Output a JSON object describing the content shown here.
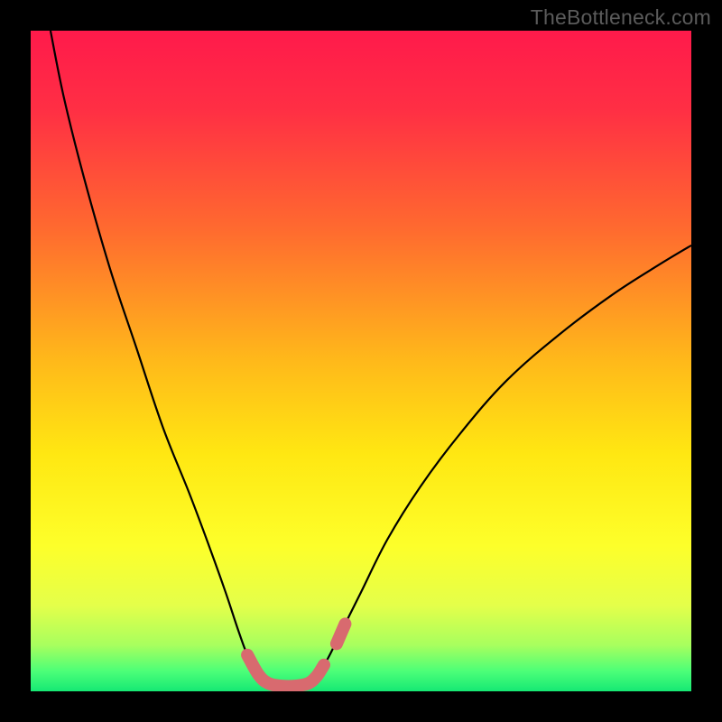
{
  "watermark": "TheBottleneck.com",
  "chart_data": {
    "type": "line",
    "title": "",
    "xlabel": "",
    "ylabel": "",
    "xlim": [
      0,
      100
    ],
    "ylim": [
      0,
      100
    ],
    "gradient_stops": [
      {
        "offset": 0.0,
        "color": "#ff1a4b"
      },
      {
        "offset": 0.12,
        "color": "#ff2f44"
      },
      {
        "offset": 0.3,
        "color": "#ff6a2f"
      },
      {
        "offset": 0.5,
        "color": "#ffb91a"
      },
      {
        "offset": 0.64,
        "color": "#ffe712"
      },
      {
        "offset": 0.78,
        "color": "#fdff2a"
      },
      {
        "offset": 0.87,
        "color": "#e4ff4a"
      },
      {
        "offset": 0.93,
        "color": "#a8ff5e"
      },
      {
        "offset": 0.97,
        "color": "#4bff78"
      },
      {
        "offset": 1.0,
        "color": "#16e874"
      }
    ],
    "series": [
      {
        "name": "curve",
        "stroke": "#000000",
        "width": 2.2,
        "points": [
          {
            "x": 3.0,
            "y": 100.0
          },
          {
            "x": 5.0,
            "y": 90.0
          },
          {
            "x": 8.0,
            "y": 78.0
          },
          {
            "x": 12.0,
            "y": 64.0
          },
          {
            "x": 16.0,
            "y": 52.0
          },
          {
            "x": 20.0,
            "y": 40.0
          },
          {
            "x": 24.0,
            "y": 30.0
          },
          {
            "x": 27.0,
            "y": 22.0
          },
          {
            "x": 29.5,
            "y": 15.0
          },
          {
            "x": 31.5,
            "y": 9.0
          },
          {
            "x": 33.0,
            "y": 5.0
          },
          {
            "x": 34.5,
            "y": 2.5
          },
          {
            "x": 36.0,
            "y": 1.2
          },
          {
            "x": 38.0,
            "y": 0.6
          },
          {
            "x": 40.0,
            "y": 0.6
          },
          {
            "x": 42.0,
            "y": 1.2
          },
          {
            "x": 43.5,
            "y": 2.5
          },
          {
            "x": 45.0,
            "y": 5.0
          },
          {
            "x": 47.0,
            "y": 9.0
          },
          {
            "x": 50.0,
            "y": 15.0
          },
          {
            "x": 54.0,
            "y": 23.0
          },
          {
            "x": 59.0,
            "y": 31.0
          },
          {
            "x": 65.0,
            "y": 39.0
          },
          {
            "x": 72.0,
            "y": 47.0
          },
          {
            "x": 80.0,
            "y": 54.0
          },
          {
            "x": 88.0,
            "y": 60.0
          },
          {
            "x": 95.0,
            "y": 64.5
          },
          {
            "x": 100.0,
            "y": 67.5
          }
        ]
      }
    ],
    "highlight": {
      "stroke": "#d86a6f",
      "width": 14,
      "cap": "round",
      "segments": [
        [
          {
            "x": 32.8,
            "y": 5.5
          },
          {
            "x": 34.5,
            "y": 2.5
          },
          {
            "x": 36.0,
            "y": 1.2
          },
          {
            "x": 38.0,
            "y": 0.8
          },
          {
            "x": 40.0,
            "y": 0.8
          },
          {
            "x": 42.0,
            "y": 1.2
          },
          {
            "x": 43.3,
            "y": 2.3
          },
          {
            "x": 44.4,
            "y": 4.0
          }
        ],
        [
          {
            "x": 46.3,
            "y": 7.2
          },
          {
            "x": 47.6,
            "y": 10.2
          }
        ]
      ]
    }
  }
}
